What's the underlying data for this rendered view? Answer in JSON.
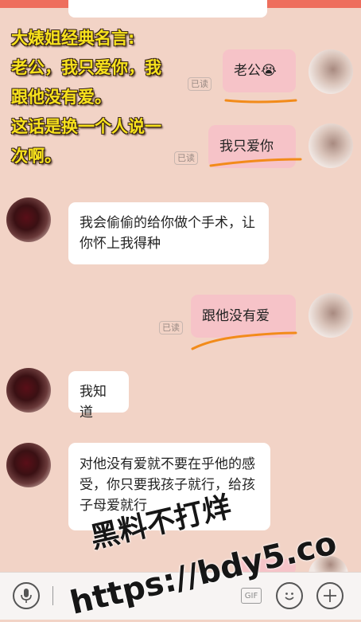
{
  "caption": {
    "lines": [
      "大婊姐经典名言:",
      "老公，我只爱你，我",
      "跟他没有爱。",
      "这话是换一个人说一",
      "次啊。"
    ]
  },
  "read_label": "已读",
  "messages": [
    {
      "side": "me",
      "text": "老公😭"
    },
    {
      "side": "me",
      "text": "我只爱你"
    },
    {
      "side": "other",
      "text": "我会偷偷的给你做个手术，让你怀上我得种"
    },
    {
      "side": "me",
      "text": "跟他没有爱"
    },
    {
      "side": "other",
      "text": "我知道"
    },
    {
      "side": "other",
      "text": "对他没有爱就不要在乎他的感受，你只要我孩子就行，给孩子母爱就行"
    }
  ],
  "input_bar": {
    "gif_label": "GIF"
  },
  "watermark": {
    "line1": "黑料不打烊",
    "line2": "https://bdy5.co"
  }
}
